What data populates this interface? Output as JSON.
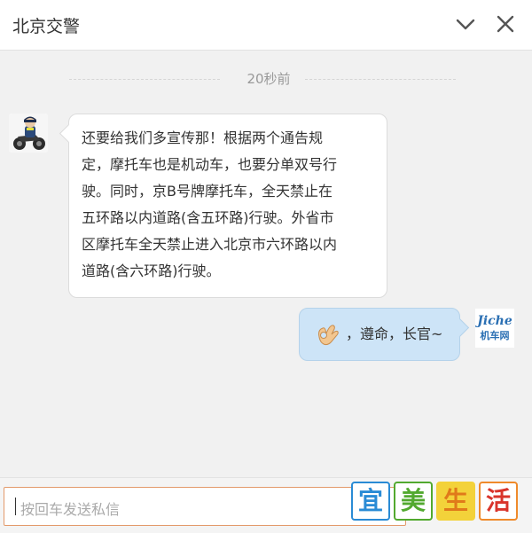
{
  "header": {
    "title": "北京交警",
    "collapse_icon": "chevron-down-icon",
    "close_icon": "close-icon"
  },
  "conversation": {
    "timestamp": "20秒前",
    "incoming": {
      "lines": [
        "还要给我们多宣传那！根据两个通告规",
        "定，摩托车也是机动车，也要分单双号行",
        "驶。同时，京B号牌摩托车，全天禁止在",
        "五环路以内道路(含五环路)行驶。外省市",
        "区摩托车全天禁止进入北京市六环路以内",
        "道路(含六环路)行驶。"
      ]
    },
    "outgoing": {
      "emoji": "ok-hand-emoji",
      "text": "，遵命，长官~"
    },
    "right_avatar": {
      "line1": "Jiche",
      "line2": "机车网"
    }
  },
  "input": {
    "placeholder": "按回车发送私信"
  },
  "watermark": {
    "chars": [
      "宜",
      "美",
      "生",
      "活"
    ]
  },
  "colors": {
    "outgoing_bubble": "#cde4f7",
    "input_border": "#e39a6b",
    "background": "#f1f1f1"
  }
}
